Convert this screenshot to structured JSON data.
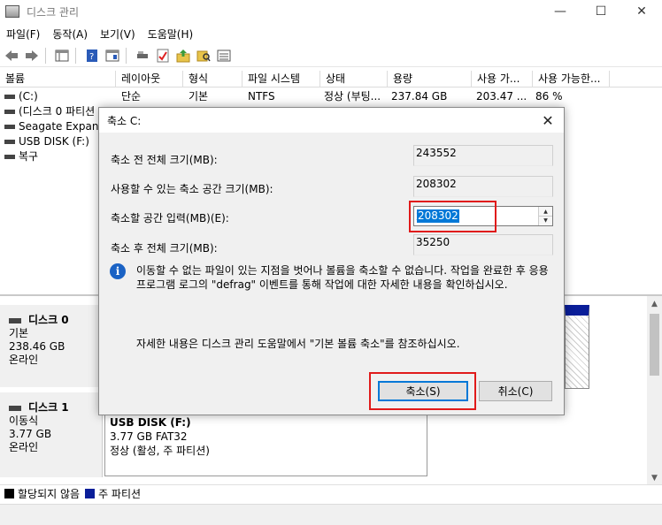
{
  "window": {
    "title": "디스크 관리",
    "min": "—",
    "max": "☐",
    "close": "✕"
  },
  "menu": [
    "파일(F)",
    "동작(A)",
    "보기(V)",
    "도움말(H)"
  ],
  "columns": [
    "볼륨",
    "레이아웃",
    "형식",
    "파일 시스템",
    "상태",
    "용량",
    "사용 가...",
    "사용 가능한..."
  ],
  "volumes": [
    {
      "name": "(C:)",
      "layout": "단순",
      "type": "기본",
      "fs": "NTFS",
      "status": "정상 (부팅...",
      "capacity": "237.84 GB",
      "free": "203.47 ...",
      "pct": "86 %"
    },
    {
      "name": "(디스크 0 파티션"
    },
    {
      "name": "Seagate Expansio"
    },
    {
      "name": "USB DISK (F:)"
    },
    {
      "name": "복구"
    }
  ],
  "disks": [
    {
      "name": "디스크 0",
      "kind": "기본",
      "size": "238.46 GB",
      "state": "온라인"
    },
    {
      "name": "디스크 1",
      "kind": "이동식",
      "size": "3.77 GB",
      "state": "온라인"
    }
  ],
  "usb_partition": {
    "title": "USB DISK (F:)",
    "size_fs": "3.77 GB FAT32",
    "status": "정상 (활성, 주 파티션)"
  },
  "legend": [
    {
      "label": "할당되지 않음",
      "color": "#000000"
    },
    {
      "label": "주 파티션",
      "color": "#0a1e99"
    }
  ],
  "dialog": {
    "title": "축소 C:",
    "close": "✕",
    "total_before_label": "축소 전 전체 크기(MB):",
    "total_before_value": "243552",
    "available_label": "사용할 수 있는 축소 공간 크기(MB):",
    "available_value": "208302",
    "shrink_label": "축소할 공간 입력(MB)(E):",
    "shrink_value": "208302",
    "total_after_label": "축소 후 전체 크기(MB):",
    "total_after_value": "35250",
    "info_text": "이동할 수 없는 파일이 있는 지점을 벗어나 볼륨을 축소할 수 없습니다. 작업을 완료한 후 응용 프로그램 로그의 \"defrag\" 이벤트를 통해 작업에 대한 자세한 내용을 확인하십시오.",
    "help_text": "자세한 내용은 디스크 관리 도움말에서 \"기본 볼륨 축소\"를 참조하십시오.",
    "shrink_button": "축소(S)",
    "cancel_button": "취소(C)"
  },
  "colors": {
    "accent": "#0078d7",
    "highlight": "#e01a1a",
    "primary_partition": "#0a1e99"
  }
}
